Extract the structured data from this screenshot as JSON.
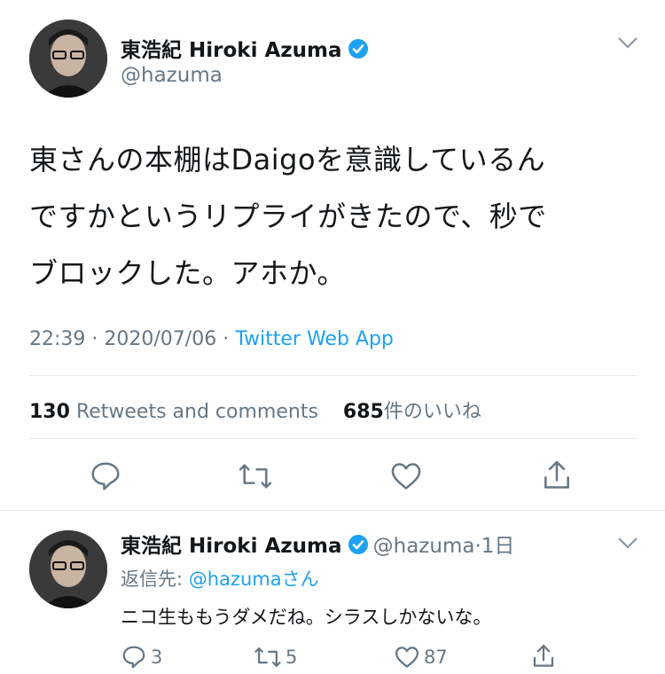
{
  "main_tweet": {
    "author_name": "東浩紀 Hiroki Azuma",
    "author_handle": "@hazuma",
    "text_lines": [
      "東さんの本棚はDaigoを意識しているん",
      "ですかというリプライがきたので、秒で",
      "ブロックした。アホか。"
    ],
    "time": "22:39",
    "date": "2020/07/06",
    "source": "Twitter Web App",
    "retweets_count": "130",
    "retweets_label": "Retweets and comments",
    "likes_count": "685",
    "likes_label": "件のいいね"
  },
  "reply_tweet": {
    "author_name": "東浩紀 Hiroki Azuma",
    "author_handle": "@hazuma",
    "age": "1日",
    "reply_to_prefix": "返信先: ",
    "reply_to_handle": "@hazumaさん",
    "text": "ニコ生ももうダメだね。シラスしかないな。",
    "reply_count": "3",
    "retweet_count": "5",
    "like_count": "87"
  },
  "colors": {
    "accent": "#1da1f2",
    "secondary_text": "#657786",
    "divider": "#e1e8ed"
  },
  "icons": [
    "verified-badge-icon",
    "chevron-down-icon",
    "reply-icon",
    "retweet-icon",
    "like-icon",
    "share-icon"
  ]
}
